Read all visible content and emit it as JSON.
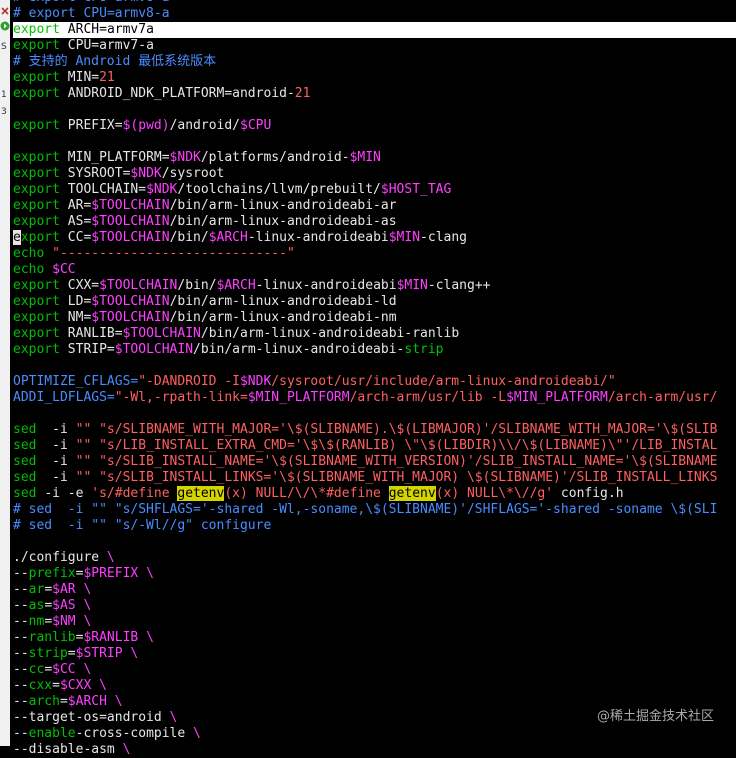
{
  "gutter": {
    "numbers": [
      "S",
      "1",
      "3"
    ]
  },
  "watermark": "@稀土掘金技术社区",
  "lines": [
    [
      [
        "c-cmt",
        "# export CPU=armv8-a"
      ]
    ],
    [
      [
        "c-cmt",
        "# export CPU=armv8-a"
      ]
    ],
    [
      [
        "c-kw",
        "export "
      ],
      [
        "c-txt",
        "ARCH="
      ],
      [
        "c-txt",
        "armv7a"
      ]
    ],
    [
      [
        "c-kw",
        "export "
      ],
      [
        "c-txt",
        "CPU=armv7-a"
      ]
    ],
    [
      [
        "c-cmt",
        "# 支持的 Android 最低系统版本"
      ]
    ],
    [
      [
        "c-kw",
        "export "
      ],
      [
        "c-txt",
        "MIN="
      ],
      [
        "c-num",
        "21"
      ]
    ],
    [
      [
        "c-kw",
        "export "
      ],
      [
        "c-txt",
        "ANDROID_NDK_PLATFORM=android-"
      ],
      [
        "c-num",
        "21"
      ]
    ],
    [],
    [
      [
        "c-kw",
        "export "
      ],
      [
        "c-txt",
        "PREFIX="
      ],
      [
        "c-var",
        "$(pwd)"
      ],
      [
        "c-txt",
        "/android/"
      ],
      [
        "c-var",
        "$CPU"
      ]
    ],
    [],
    [
      [
        "c-kw",
        "export "
      ],
      [
        "c-txt",
        "MIN_PLATFORM="
      ],
      [
        "c-var",
        "$NDK"
      ],
      [
        "c-txt",
        "/platforms/android-"
      ],
      [
        "c-var",
        "$MIN"
      ]
    ],
    [
      [
        "c-kw",
        "export "
      ],
      [
        "c-txt",
        "SYSROOT="
      ],
      [
        "c-var",
        "$NDK"
      ],
      [
        "c-txt",
        "/sysroot"
      ]
    ],
    [
      [
        "c-kw",
        "export "
      ],
      [
        "c-txt",
        "TOOLCHAIN="
      ],
      [
        "c-var",
        "$NDK"
      ],
      [
        "c-txt",
        "/toolchains/llvm/prebuilt/"
      ],
      [
        "c-var",
        "$HOST_TAG"
      ]
    ],
    [
      [
        "c-kw",
        "export "
      ],
      [
        "c-txt",
        "AR="
      ],
      [
        "c-var",
        "$TOOLCHAIN"
      ],
      [
        "c-txt",
        "/bin/arm-linux-androideabi-ar"
      ]
    ],
    [
      [
        "c-kw",
        "export "
      ],
      [
        "c-txt",
        "AS="
      ],
      [
        "c-var",
        "$TOOLCHAIN"
      ],
      [
        "c-txt",
        "/bin/arm-linux-androideabi-as"
      ]
    ],
    [
      [
        "c-cur",
        "e"
      ],
      [
        "c-kw",
        "xport "
      ],
      [
        "c-txt",
        "CC="
      ],
      [
        "c-var",
        "$TOOLCHAIN"
      ],
      [
        "c-txt",
        "/bin/"
      ],
      [
        "c-var",
        "$ARCH"
      ],
      [
        "c-txt",
        "-linux-androideabi"
      ],
      [
        "c-var",
        "$MIN"
      ],
      [
        "c-txt",
        "-clang"
      ]
    ],
    [
      [
        "c-kw",
        "echo "
      ],
      [
        "c-str",
        "\"-----------------------------\""
      ]
    ],
    [
      [
        "c-kw",
        "echo "
      ],
      [
        "c-var",
        "$CC"
      ]
    ],
    [
      [
        "c-kw",
        "export "
      ],
      [
        "c-txt",
        "CXX="
      ],
      [
        "c-var",
        "$TOOLCHAIN"
      ],
      [
        "c-txt",
        "/bin/"
      ],
      [
        "c-var",
        "$ARCH"
      ],
      [
        "c-txt",
        "-linux-androideabi"
      ],
      [
        "c-var",
        "$MIN"
      ],
      [
        "c-txt",
        "-clang++"
      ]
    ],
    [
      [
        "c-kw",
        "export "
      ],
      [
        "c-txt",
        "LD="
      ],
      [
        "c-var",
        "$TOOLCHAIN"
      ],
      [
        "c-txt",
        "/bin/arm-linux-androideabi-ld"
      ]
    ],
    [
      [
        "c-kw",
        "export "
      ],
      [
        "c-txt",
        "NM="
      ],
      [
        "c-var",
        "$TOOLCHAIN"
      ],
      [
        "c-txt",
        "/bin/arm-linux-androideabi-nm"
      ]
    ],
    [
      [
        "c-kw",
        "export "
      ],
      [
        "c-txt",
        "RANLIB="
      ],
      [
        "c-var",
        "$TOOLCHAIN"
      ],
      [
        "c-txt",
        "/bin/arm-linux-androideabi-ranlib"
      ]
    ],
    [
      [
        "c-kw",
        "export "
      ],
      [
        "c-txt",
        "STRIP="
      ],
      [
        "c-var",
        "$TOOLCHAIN"
      ],
      [
        "c-txt",
        "/bin/arm-linux-androideabi-"
      ],
      [
        "c-kw",
        "strip"
      ]
    ],
    [],
    [
      [
        "c-cmt",
        "OPTIMIZE_CFLAGS="
      ],
      [
        "c-str",
        "\"-DANDROID -I"
      ],
      [
        "c-var",
        "$NDK"
      ],
      [
        "c-str",
        "/sysroot/usr/include/arm-linux-androideabi/\""
      ]
    ],
    [
      [
        "c-cmt",
        "ADDI_LDFLAGS="
      ],
      [
        "c-str",
        "\"-Wl,-rpath-link="
      ],
      [
        "c-var",
        "$MIN_PLATFORM"
      ],
      [
        "c-str",
        "/arch-arm/usr/lib -L"
      ],
      [
        "c-var",
        "$MIN_PLATFORM"
      ],
      [
        "c-str",
        "/arch-arm/usr/"
      ]
    ],
    [],
    [
      [
        "c-kw",
        "sed "
      ],
      [
        "c-txt",
        " -i "
      ],
      [
        "c-str",
        "\"\""
      ],
      [
        "c-txt",
        " "
      ],
      [
        "c-str",
        "\"s/SLIBNAME_WITH_MAJOR='\\$(SLIBNAME).\\$(LIBMAJOR)'/SLIBNAME_WITH_MAJOR='\\$(SLIB"
      ]
    ],
    [
      [
        "c-kw",
        "sed "
      ],
      [
        "c-txt",
        " -i "
      ],
      [
        "c-str",
        "\"\""
      ],
      [
        "c-txt",
        " "
      ],
      [
        "c-str",
        "\"s/LIB_INSTALL_EXTRA_CMD='\\$\\$(RANLIB) \\\"\\$(LIBDIR)\\\\/\\$(LIBNAME)\\\"'/LIB_INSTAL"
      ]
    ],
    [
      [
        "c-kw",
        "sed "
      ],
      [
        "c-txt",
        " -i "
      ],
      [
        "c-str",
        "\"\""
      ],
      [
        "c-txt",
        " "
      ],
      [
        "c-str",
        "\"s/SLIB_INSTALL_NAME='\\$(SLIBNAME_WITH_VERSION)'/SLIB_INSTALL_NAME='\\$(SLIBNAME"
      ]
    ],
    [
      [
        "c-kw",
        "sed "
      ],
      [
        "c-txt",
        " -i "
      ],
      [
        "c-str",
        "\"\""
      ],
      [
        "c-txt",
        " "
      ],
      [
        "c-str",
        "\"s/SLIB_INSTALL_LINKS='\\$(SLIBNAME_WITH_MAJOR) \\$(SLIBNAME)'/SLIB_INSTALL_LINKS"
      ]
    ],
    [
      [
        "c-kw",
        "sed "
      ],
      [
        "c-txt",
        "-i -e "
      ],
      [
        "c-str",
        "'s/#define "
      ],
      [
        "c-hl",
        "getenv"
      ],
      [
        "c-str",
        "(x) NULL/\\/\\*#define "
      ],
      [
        "c-hl",
        "getenv"
      ],
      [
        "c-str",
        "(x) NULL\\*\\//g'"
      ],
      [
        "c-txt",
        " config.h"
      ]
    ],
    [
      [
        "c-cmt",
        "# sed  -i \"\" \"s/SHFLAGS='-shared -Wl,-soname,\\$(SLIBNAME)'/SHFLAGS='-shared -soname \\$(SLI"
      ]
    ],
    [
      [
        "c-cmt",
        "# sed  -i \"\" \"s/-Wl//g\" configure"
      ]
    ],
    [],
    [
      [
        "c-txt",
        "./configure "
      ],
      [
        "c-var",
        "\\"
      ]
    ],
    [
      [
        "c-txt",
        "--"
      ],
      [
        "c-kw",
        "prefix"
      ],
      [
        "c-txt",
        "="
      ],
      [
        "c-var",
        "$PREFIX"
      ],
      [
        "c-txt",
        " "
      ],
      [
        "c-var",
        "\\"
      ]
    ],
    [
      [
        "c-txt",
        "--"
      ],
      [
        "c-kw",
        "ar"
      ],
      [
        "c-txt",
        "="
      ],
      [
        "c-var",
        "$AR"
      ],
      [
        "c-txt",
        " "
      ],
      [
        "c-var",
        "\\"
      ]
    ],
    [
      [
        "c-txt",
        "--"
      ],
      [
        "c-kw",
        "as"
      ],
      [
        "c-txt",
        "="
      ],
      [
        "c-var",
        "$AS"
      ],
      [
        "c-txt",
        " "
      ],
      [
        "c-var",
        "\\"
      ]
    ],
    [
      [
        "c-txt",
        "--"
      ],
      [
        "c-kw",
        "nm"
      ],
      [
        "c-txt",
        "="
      ],
      [
        "c-var",
        "$NM"
      ],
      [
        "c-txt",
        " "
      ],
      [
        "c-var",
        "\\"
      ]
    ],
    [
      [
        "c-txt",
        "--"
      ],
      [
        "c-kw",
        "ranlib"
      ],
      [
        "c-txt",
        "="
      ],
      [
        "c-var",
        "$RANLIB"
      ],
      [
        "c-txt",
        " "
      ],
      [
        "c-var",
        "\\"
      ]
    ],
    [
      [
        "c-txt",
        "--"
      ],
      [
        "c-kw",
        "strip"
      ],
      [
        "c-txt",
        "="
      ],
      [
        "c-var",
        "$STRIP"
      ],
      [
        "c-txt",
        " "
      ],
      [
        "c-var",
        "\\"
      ]
    ],
    [
      [
        "c-txt",
        "--"
      ],
      [
        "c-kw",
        "cc"
      ],
      [
        "c-txt",
        "="
      ],
      [
        "c-var",
        "$CC"
      ],
      [
        "c-txt",
        " "
      ],
      [
        "c-var",
        "\\"
      ]
    ],
    [
      [
        "c-txt",
        "--"
      ],
      [
        "c-kw",
        "cxx"
      ],
      [
        "c-txt",
        "="
      ],
      [
        "c-var",
        "$CXX"
      ],
      [
        "c-txt",
        " "
      ],
      [
        "c-var",
        "\\"
      ]
    ],
    [
      [
        "c-txt",
        "--"
      ],
      [
        "c-kw",
        "arch"
      ],
      [
        "c-txt",
        "="
      ],
      [
        "c-var",
        "$ARCH"
      ],
      [
        "c-txt",
        " "
      ],
      [
        "c-var",
        "\\"
      ]
    ],
    [
      [
        "c-txt",
        "--target-os=android "
      ],
      [
        "c-var",
        "\\"
      ]
    ],
    [
      [
        "c-txt",
        "--"
      ],
      [
        "c-kw",
        "enable"
      ],
      [
        "c-txt",
        "-cross-compile "
      ],
      [
        "c-var",
        "\\"
      ]
    ],
    [
      [
        "c-txt",
        "--disable-asm "
      ],
      [
        "c-var",
        "\\"
      ]
    ]
  ]
}
